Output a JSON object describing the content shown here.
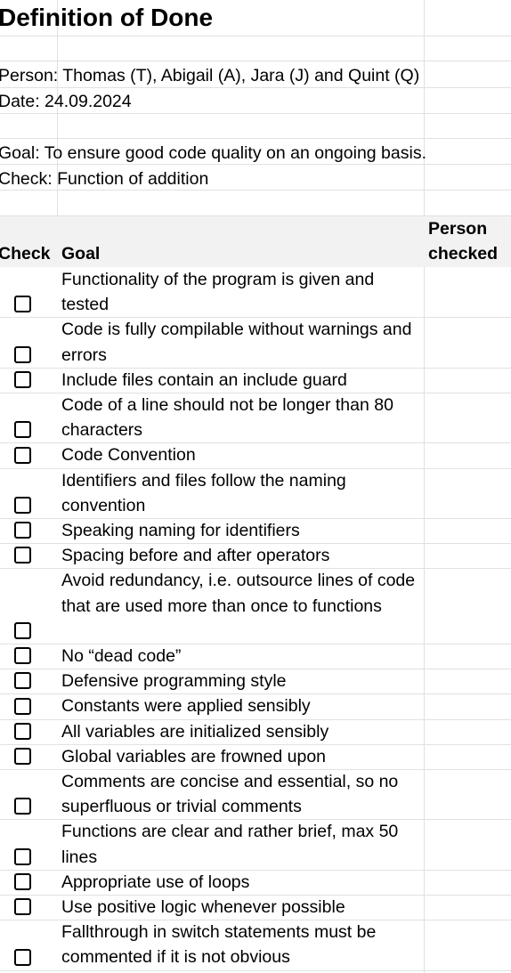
{
  "title": "Definition of Done",
  "person_line": "Person: Thomas (T), Abigail (A), Jara (J) and Quint (Q)",
  "date_line": "Date: 24.09.2024",
  "goal_line": "Goal: To ensure good code quality on an ongoing basis.",
  "check_line": "Check: Function of addition",
  "table": {
    "headers": {
      "check": "Check",
      "goal": "Goal",
      "person_1": "Person",
      "person_2": "checked"
    },
    "rows": [
      {
        "goal": "Functionality of the program is given and tested",
        "checked": false
      },
      {
        "goal": "Code is fully compilable without warnings and errors",
        "checked": false
      },
      {
        "goal": "Include files contain an include guard",
        "checked": false
      },
      {
        "goal": "Code of a line should not be longer than 80 characters",
        "checked": false
      },
      {
        "goal": "Code Convention",
        "checked": false
      },
      {
        "goal": "Identifiers and files follow the naming convention",
        "checked": false
      },
      {
        "goal": "Speaking naming for identifiers",
        "checked": false
      },
      {
        "goal": "Spacing before and after operators",
        "checked": false
      },
      {
        "goal": "Avoid redundancy, i.e. outsource lines of code that are used more than once to functions",
        "checked": false
      },
      {
        "goal": "No “dead code”",
        "checked": false
      },
      {
        "goal": "Defensive programming style",
        "checked": false
      },
      {
        "goal": "Constants were applied sensibly",
        "checked": false
      },
      {
        "goal": "All variables are initialized sensibly",
        "checked": false
      },
      {
        "goal": "Global variables are frowned upon",
        "checked": false
      },
      {
        "goal": "Comments are concise and essential, so no superfluous or trivial comments",
        "checked": false
      },
      {
        "goal": "Functions are clear and rather brief, max 50 lines",
        "checked": false
      },
      {
        "goal": "Appropriate use of loops",
        "checked": false
      },
      {
        "goal": "Use positive logic whenever possible",
        "checked": false
      },
      {
        "goal": "Fallthrough in switch statements must be commented if it is not obvious",
        "checked": false
      }
    ]
  }
}
